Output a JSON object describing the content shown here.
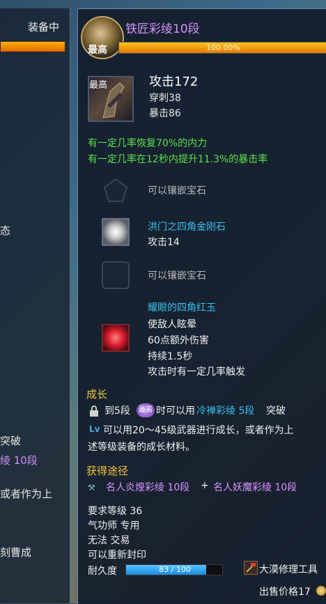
{
  "background_panel": {
    "title": "装备中",
    "fragments": [
      "态",
      "突破",
      "绫 10段",
      "或者作为上",
      "刻曹成"
    ]
  },
  "tooltip": {
    "item_name": "铁匠彩绫10段",
    "emblem_label": "最高",
    "growth_progress": {
      "value": 1.0,
      "text": "100.00%"
    },
    "weapon_icon_label": "最高",
    "stats": {
      "attack": "攻击172",
      "pierce": "穿刺38",
      "crit": "暴击86"
    },
    "effects": [
      "有一定几率恢复70%的内力",
      "有一定几率在12秒内提升11.3%的暴击率"
    ],
    "gem_slots": [
      {
        "icon": "empty-pentagon-socket-icon",
        "text": "可以镶嵌宝石"
      },
      {
        "icon": "diamond-gem-icon",
        "name": "洪门之四角金刚石",
        "effect": "攻击14"
      },
      {
        "icon": "empty-square-socket-icon",
        "text": "可以镶嵌宝石"
      },
      {
        "icon": "ruby-gem-icon",
        "name": "耀眼的四角红玉",
        "effects": [
          "使敌人眩晕",
          "60点额外伤害",
          "持续1.5秒",
          "攻击时有一定几率触发"
        ]
      }
    ],
    "growth": {
      "title": "成长",
      "line1": {
        "prefix": "到5段",
        "badge": "最高",
        "mid": "时可以用",
        "target": "冷禅彩绫 5段",
        "suffix": "突破"
      },
      "line2": "可以用20～45级武器进行成长，或者作为上",
      "line3": "述等级装备的成长材料。"
    },
    "source": {
      "title": "获得途径",
      "item_a": "名人炎煌彩绫 10段",
      "plus": "+",
      "item_b": "名人妖魔彩绫 10段"
    },
    "requirements": {
      "level": "要求等级 36",
      "class": "气功师 专用",
      "trade": "无法 交易",
      "reseal": "可以重新封印"
    },
    "durability": {
      "label": "耐久度",
      "text": "83 / 100",
      "current": 83,
      "max": 100
    },
    "repair_tool": "大漠修理工具",
    "sell_price": "出售价格17"
  },
  "colors": {
    "title_purple": "#d693ff",
    "effect_green": "#5ce04a",
    "gem_blue": "#38c0f0",
    "section_gold": "#f2c640",
    "progress_orange": "#e07a00",
    "durability_blue": "#1c8ae0"
  }
}
